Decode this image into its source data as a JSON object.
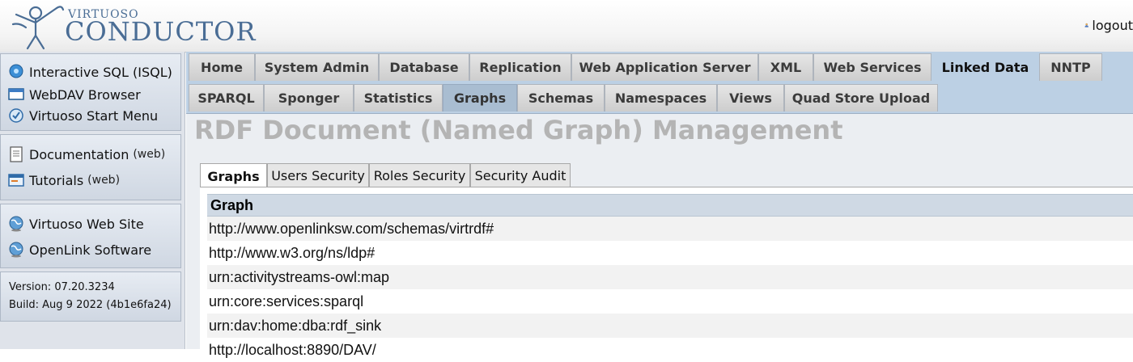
{
  "header": {
    "logo_small": "VIRTUOSO",
    "logo_big": "CONDUCTOR",
    "user_label": "logout"
  },
  "sidebar": {
    "group1": [
      {
        "label": "Interactive SQL (ISQL)",
        "icon": "isql-icon"
      },
      {
        "label": "WebDAV Browser",
        "icon": "webdav-icon"
      },
      {
        "label": "Virtuoso Start Menu",
        "icon": "start-menu-icon"
      }
    ],
    "group2": [
      {
        "label": "Documentation",
        "suffix": "(web)",
        "icon": "documentation-icon"
      },
      {
        "label": "Tutorials",
        "suffix": "(web)",
        "icon": "tutorials-icon"
      }
    ],
    "group3": [
      {
        "label": "Virtuoso Web Site",
        "icon": "globe-icon"
      },
      {
        "label": "OpenLink Software",
        "icon": "globe-icon"
      }
    ],
    "version": "Version: 07.20.3234",
    "build": "Build: Aug 9 2022 (4b1e6fa24)"
  },
  "tabs_primary": [
    "Home",
    "System Admin",
    "Database",
    "Replication",
    "Web Application Server",
    "XML",
    "Web Services",
    "Linked Data",
    "NNTP"
  ],
  "tabs_primary_active": "Linked Data",
  "tabs_secondary": [
    "SPARQL",
    "Sponger",
    "Statistics",
    "Graphs",
    "Schemas",
    "Namespaces",
    "Views",
    "Quad Store Upload"
  ],
  "tabs_secondary_active": "Graphs",
  "page_title": "RDF Document (Named Graph) Management",
  "subtabs": [
    "Graphs",
    "Users Security",
    "Roles Security",
    "Security Audit"
  ],
  "subtabs_active": "Graphs",
  "table": {
    "header": "Graph",
    "rows": [
      "http://www.openlinksw.com/schemas/virtrdf#",
      "http://www.w3.org/ns/ldp#",
      "urn:activitystreams-owl:map",
      "urn:core:services:sparql",
      "urn:dav:home:dba:rdf_sink",
      "http://localhost:8890/DAV/"
    ]
  },
  "colors": {
    "tab_bar": "#bcd0e4",
    "title_gray": "#b4b4b4",
    "logo_blue": "#4a6d95"
  }
}
